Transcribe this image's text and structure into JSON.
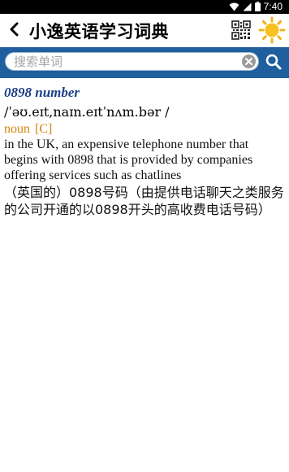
{
  "status": {
    "time": "7:40"
  },
  "header": {
    "title": "小逸英语学习词典"
  },
  "search": {
    "placeholder": "搜索单词",
    "value": ""
  },
  "entry": {
    "headword": "0898 number",
    "phonetic": "/ˈəʊ.eɪt,naɪn.eɪtˈnʌm.bər /",
    "pos": "noun",
    "grammar": "[C]",
    "definition_en": "in the UK, an expensive telephone number that begins with 0898 that is provided by companies offering services such as chatlines",
    "definition_zh": "（英国的）0898号码（由提供电话聊天之类服务的公司开通的以0898开头的高收费电话号码）"
  },
  "colors": {
    "accent": "#1f5f9e",
    "headword": "#1c3f87",
    "pos": "#d4850d"
  }
}
